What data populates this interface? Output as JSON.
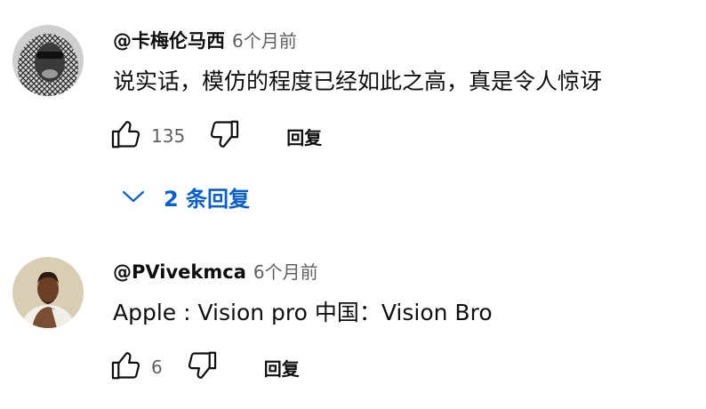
{
  "comments": [
    {
      "author": "@卡梅伦马西",
      "time": "6个月前",
      "text": "说实话，模仿的程度已经如此之高，真是令人惊讶",
      "likes": "135",
      "reply_label": "回复",
      "replies_toggle": "2 条回复"
    },
    {
      "author": "@PVivekmca",
      "time": "6个月前",
      "text": "Apple : Vision pro 中国：Vision Bro",
      "likes": "6",
      "reply_label": "回复"
    }
  ],
  "icons": {
    "like": "thumbs-up-icon",
    "dislike": "thumbs-down-icon",
    "expand": "chevron-down-icon"
  },
  "colors": {
    "link": "#065fd4",
    "secondary_text": "#606060",
    "primary_text": "#0f0f0f"
  }
}
